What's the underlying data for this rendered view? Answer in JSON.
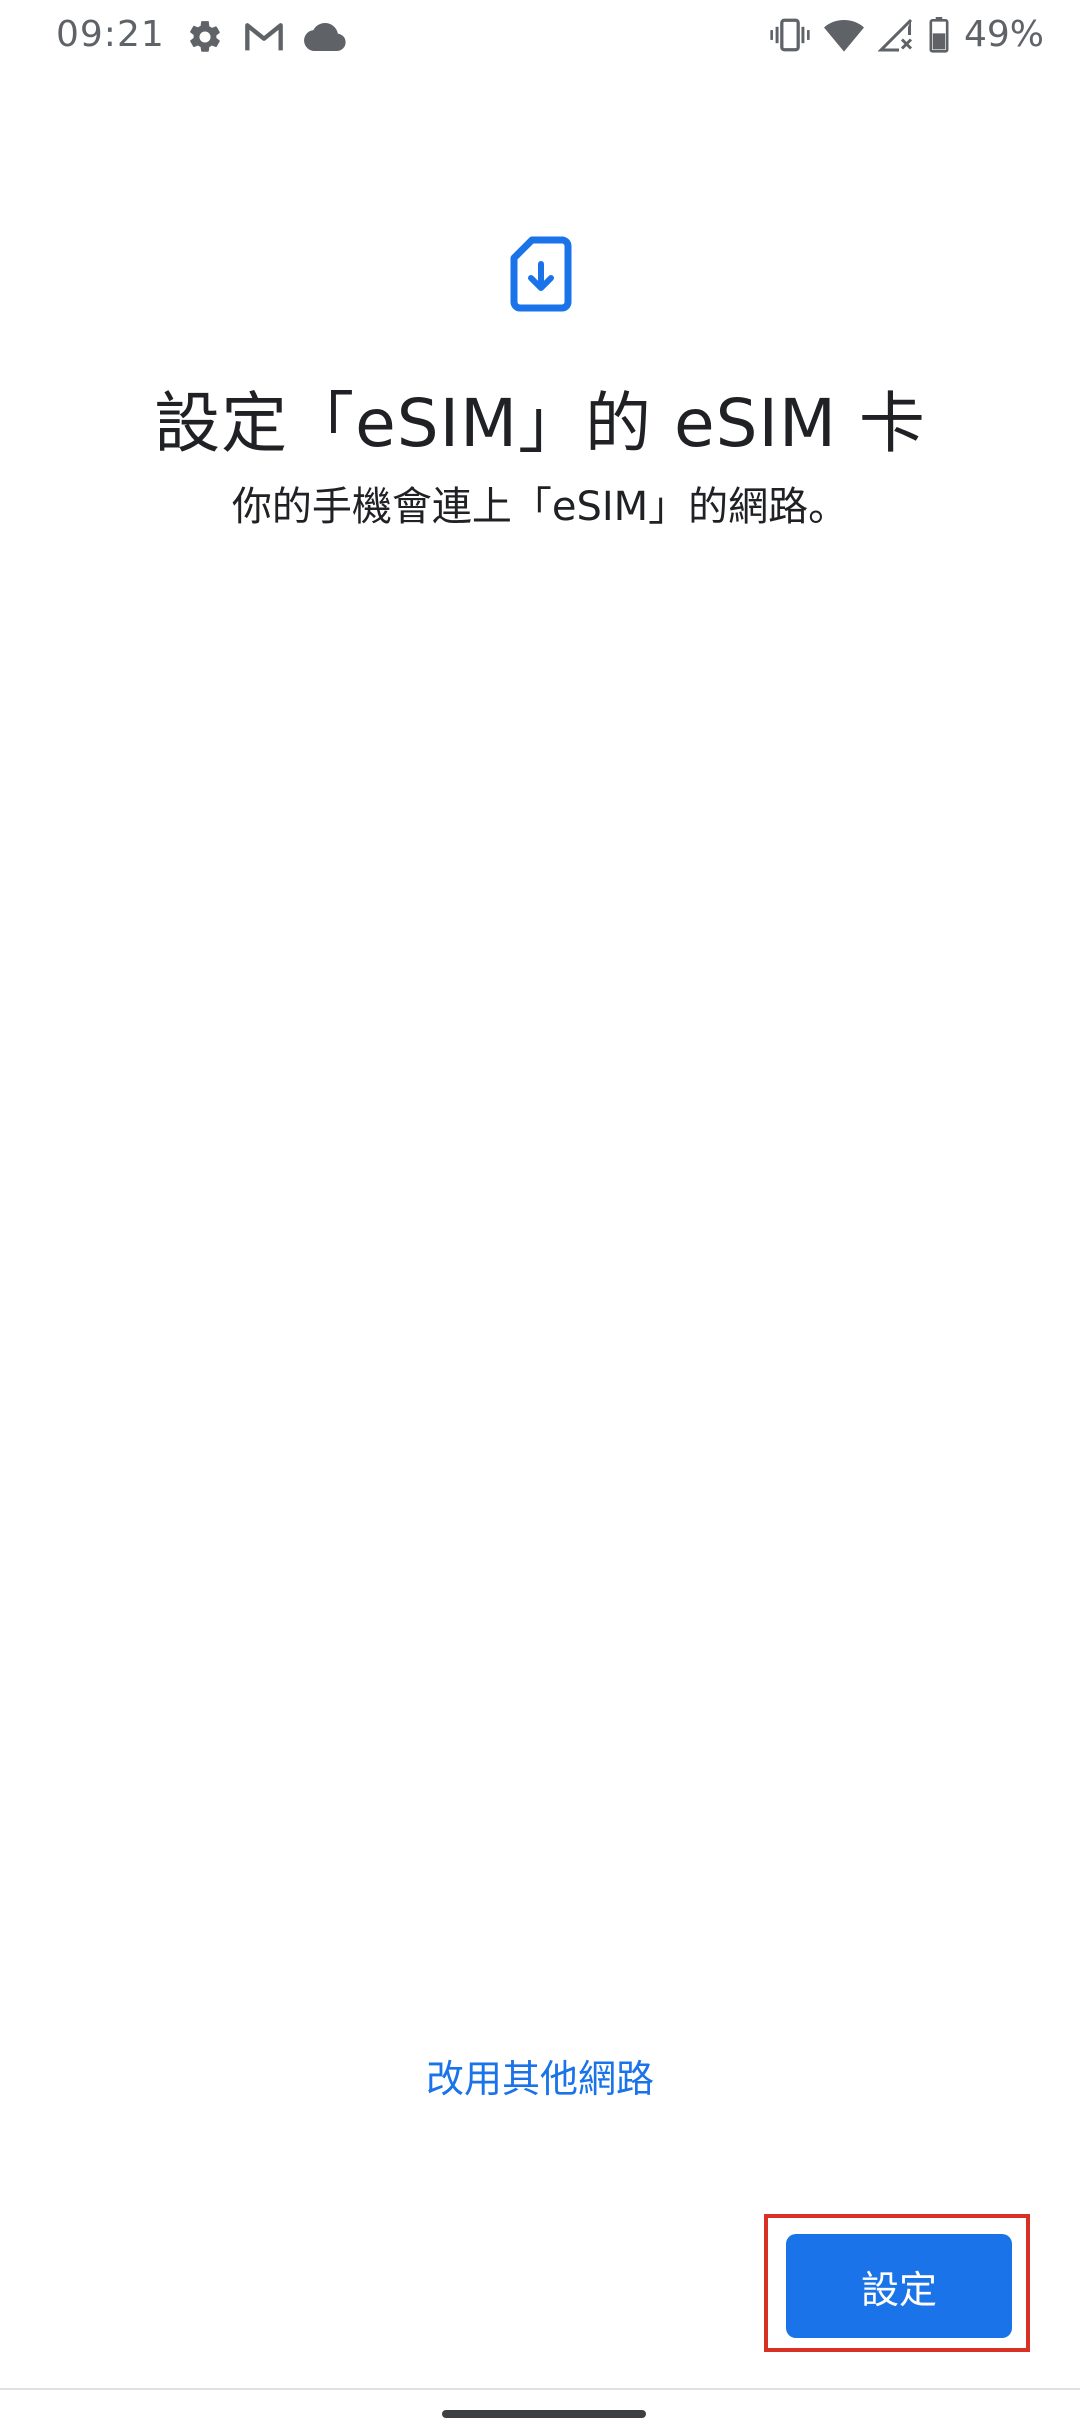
{
  "status_bar": {
    "time": "09:21",
    "battery_percent": "49%",
    "left_icons": [
      "gear-icon",
      "gmail-icon",
      "cloud-icon"
    ],
    "right_icons": [
      "vibrate-icon",
      "wifi-icon",
      "signal-off-icon",
      "battery-icon"
    ]
  },
  "screen": {
    "title": "設定「eSIM」的 eSIM 卡",
    "subtitle": "你的手機會連上「eSIM」的網路。",
    "header_icon": "esim-download-icon"
  },
  "actions": {
    "alt_network_label": "改用其他網路",
    "setup_label": "設定"
  },
  "colors": {
    "accent": "#1a73e8",
    "text": "#202124",
    "status": "#5f6368",
    "highlight": "#d93025"
  }
}
